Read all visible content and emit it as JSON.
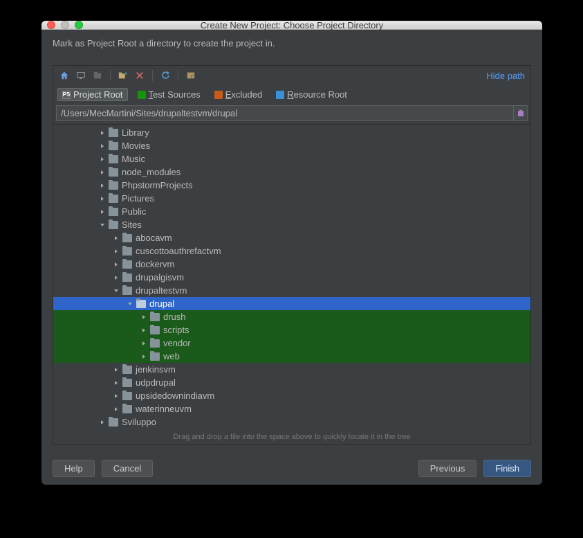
{
  "window": {
    "title": "Create New Project: Choose Project Directory"
  },
  "instruction": "Mark as Project Root a directory to create the project in.",
  "toolbar": {
    "hide_path": "Hide path"
  },
  "filters": {
    "project_root": "Project Root",
    "test_sources_pre": "T",
    "test_sources": "est Sources",
    "excluded_pre": "E",
    "excluded": "xcluded",
    "resource_root_pre": "R",
    "resource_root": "esource Root"
  },
  "path": "/Users/MecMartini/Sites/drupaltestvm/drupal",
  "tree": [
    {
      "label": "Library",
      "depth": 3,
      "expand": "closed",
      "sel": false,
      "green": false
    },
    {
      "label": "Movies",
      "depth": 3,
      "expand": "closed",
      "sel": false,
      "green": false
    },
    {
      "label": "Music",
      "depth": 3,
      "expand": "closed",
      "sel": false,
      "green": false
    },
    {
      "label": "node_modules",
      "depth": 3,
      "expand": "closed",
      "sel": false,
      "green": false
    },
    {
      "label": "PhpstormProjects",
      "depth": 3,
      "expand": "closed",
      "sel": false,
      "green": false
    },
    {
      "label": "Pictures",
      "depth": 3,
      "expand": "closed",
      "sel": false,
      "green": false
    },
    {
      "label": "Public",
      "depth": 3,
      "expand": "closed",
      "sel": false,
      "green": false
    },
    {
      "label": "Sites",
      "depth": 3,
      "expand": "open",
      "sel": false,
      "green": false
    },
    {
      "label": "abocavm",
      "depth": 4,
      "expand": "closed",
      "sel": false,
      "green": false
    },
    {
      "label": "cuscottoauthrefactvm",
      "depth": 4,
      "expand": "closed",
      "sel": false,
      "green": false
    },
    {
      "label": "dockervm",
      "depth": 4,
      "expand": "closed",
      "sel": false,
      "green": false
    },
    {
      "label": "drupalgisvm",
      "depth": 4,
      "expand": "closed",
      "sel": false,
      "green": false
    },
    {
      "label": "drupaltestvm",
      "depth": 4,
      "expand": "open",
      "sel": false,
      "green": false
    },
    {
      "label": "drupal",
      "depth": 5,
      "expand": "open",
      "sel": true,
      "green": false
    },
    {
      "label": "drush",
      "depth": 6,
      "expand": "closed",
      "sel": false,
      "green": true
    },
    {
      "label": "scripts",
      "depth": 6,
      "expand": "closed",
      "sel": false,
      "green": true
    },
    {
      "label": "vendor",
      "depth": 6,
      "expand": "closed",
      "sel": false,
      "green": true
    },
    {
      "label": "web",
      "depth": 6,
      "expand": "closed",
      "sel": false,
      "green": true
    },
    {
      "label": "jenkinsvm",
      "depth": 4,
      "expand": "closed",
      "sel": false,
      "green": false
    },
    {
      "label": "udpdrupal",
      "depth": 4,
      "expand": "closed",
      "sel": false,
      "green": false
    },
    {
      "label": "upsidedownindiavm",
      "depth": 4,
      "expand": "closed",
      "sel": false,
      "green": false
    },
    {
      "label": "waterinneuvm",
      "depth": 4,
      "expand": "closed",
      "sel": false,
      "green": false
    },
    {
      "label": "Sviluppo",
      "depth": 3,
      "expand": "closed",
      "sel": false,
      "green": false
    }
  ],
  "hint": "Drag and drop a file into the space above to quickly locate it in the tree",
  "footer": {
    "help": "Help",
    "cancel": "Cancel",
    "previous": "Previous",
    "finish": "Finish"
  }
}
